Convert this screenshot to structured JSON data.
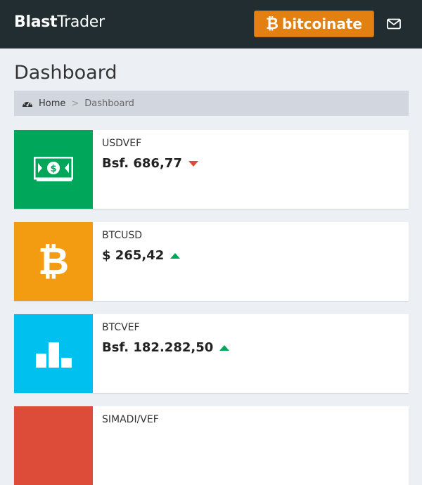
{
  "header": {
    "logo_bold": "Blast",
    "logo_rest": "Trader",
    "brand_button": {
      "symbol": "₿",
      "label": "bitcoinate",
      "color": "#e28112"
    },
    "mail_icon": "envelope-icon",
    "bg_color": "#222d32"
  },
  "page": {
    "title": "Dashboard",
    "breadcrumb": {
      "icon": "dashboard-icon",
      "home": "Home",
      "separator": ">",
      "current": "Dashboard"
    }
  },
  "cards": [
    {
      "label": "USDVEF",
      "value": "Bsf. 686,77",
      "trend": "down",
      "icon": "money-bill-icon",
      "color": "#00a65a"
    },
    {
      "label": "BTCUSD",
      "value": "$ 265,42",
      "trend": "up",
      "icon": "bitcoin-icon",
      "color": "#f39c12"
    },
    {
      "label": "BTCVEF",
      "value": "Bsf. 182.282,50",
      "trend": "up",
      "icon": "bar-chart-icon",
      "color": "#00c0ef"
    },
    {
      "label": "SIMADI/VEF",
      "value": "",
      "trend": "",
      "icon": "",
      "color": "#dd4b39"
    }
  ],
  "trend_colors": {
    "up": "#00a65a",
    "down": "#dd4b39"
  }
}
